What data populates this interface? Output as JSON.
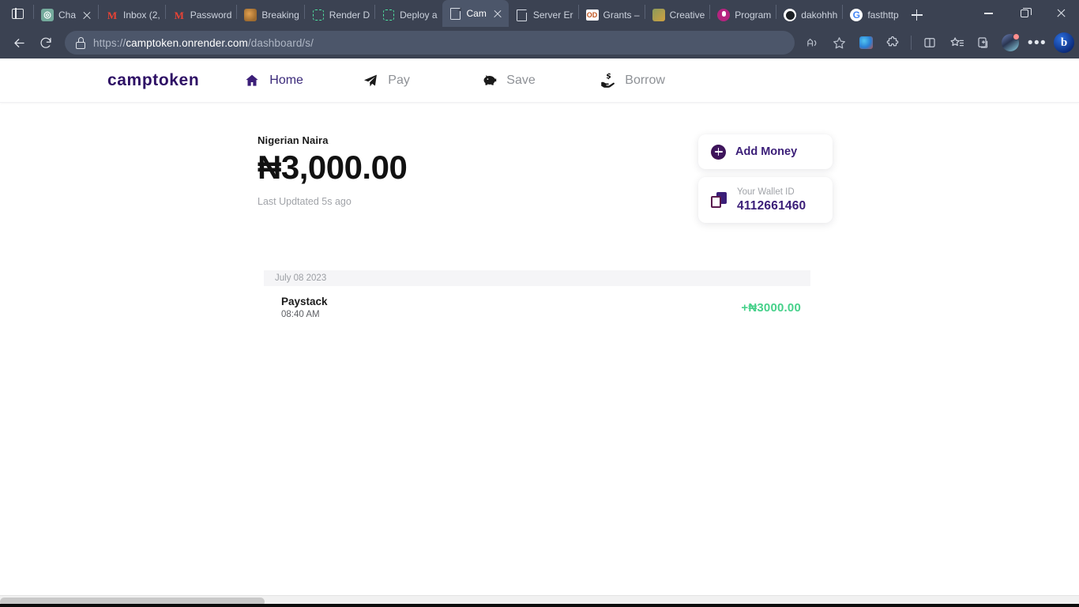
{
  "browser": {
    "tab_panel_icon": "tab-panel-icon",
    "tabs": [
      {
        "title": "Cha",
        "icon": "chatgpt-favicon",
        "active": false,
        "closable": true
      },
      {
        "title": "Inbox (2,",
        "icon": "gmail-favicon",
        "active": false,
        "closable": false
      },
      {
        "title": "Password",
        "icon": "gmail-favicon",
        "active": false,
        "closable": false
      },
      {
        "title": "Breaking",
        "icon": "news-favicon",
        "active": false,
        "closable": false
      },
      {
        "title": "Render D",
        "icon": "render-favicon",
        "active": false,
        "closable": false
      },
      {
        "title": "Deploy a",
        "icon": "render-favicon",
        "active": false,
        "closable": false
      },
      {
        "title": "Cam",
        "icon": "document-favicon",
        "active": true,
        "closable": true
      },
      {
        "title": "Server Er",
        "icon": "document-favicon",
        "active": false,
        "closable": false
      },
      {
        "title": "Grants –",
        "icon": "od-favicon",
        "active": false,
        "closable": false
      },
      {
        "title": "Creative",
        "icon": "creative-favicon",
        "active": false,
        "closable": false
      },
      {
        "title": "Program",
        "icon": "microphone-favicon",
        "active": false,
        "closable": false
      },
      {
        "title": "dakohhh",
        "icon": "github-favicon",
        "active": false,
        "closable": false
      },
      {
        "title": "fasthttp",
        "icon": "google-favicon",
        "active": false,
        "closable": false
      }
    ],
    "new_tab_label": "+",
    "window_controls": [
      "minimize",
      "restore",
      "close"
    ],
    "toolbar": {
      "back_icon": "back-arrow-icon",
      "reload_icon": "reload-icon",
      "lock_icon": "lock-icon",
      "url_scheme": "https://",
      "url_host": "camptoken.onrender.com",
      "url_path": "/dashboard/s/",
      "read_aloud_icon": "read-aloud-icon",
      "favorite_icon": "star-icon",
      "extension_icons": [
        "idm-extension-icon",
        "puzzle-extension-icon"
      ],
      "split_screen_icon": "split-screen-icon",
      "favorites_icon": "favorites-star-list-icon",
      "collections_icon": "collections-icon",
      "profile_icon": "profile-avatar-icon",
      "settings_icon": "more-options-icon",
      "copilot_icon": "bing-copilot-icon"
    }
  },
  "site": {
    "logo": "camptoken",
    "nav": [
      {
        "label": "Home",
        "icon": "home-icon",
        "active": true
      },
      {
        "label": "Pay",
        "icon": "paper-plane-icon",
        "active": false
      },
      {
        "label": "Save",
        "icon": "piggy-bank-icon",
        "active": false
      },
      {
        "label": "Borrow",
        "icon": "hand-money-icon",
        "active": false
      }
    ],
    "balance": {
      "currency_label": "Nigerian Naira",
      "amount": "₦3,000.00",
      "updated": "Last Updtated 5s ago"
    },
    "actions": {
      "add_money_label": "Add Money",
      "add_money_icon": "plus-circle-icon",
      "wallet_copy_icon": "copy-icon",
      "wallet_label": "Your Wallet ID",
      "wallet_id": "4112661460"
    },
    "transactions": {
      "groups": [
        {
          "date": "July 08 2023",
          "items": [
            {
              "name": "Paystack",
              "time": "08:40 AM",
              "amount": "+₦3000.00",
              "direction": "credit"
            }
          ]
        }
      ]
    },
    "colors": {
      "brand_purple": "#2e1065",
      "nav_active": "#3b2a7a",
      "accent_purple": "#3b1e78",
      "credit_green": "#46d18a",
      "muted_text": "#a0a3a8",
      "date_bar_bg": "#f5f5f7",
      "chrome_bg": "#3b4252"
    }
  }
}
